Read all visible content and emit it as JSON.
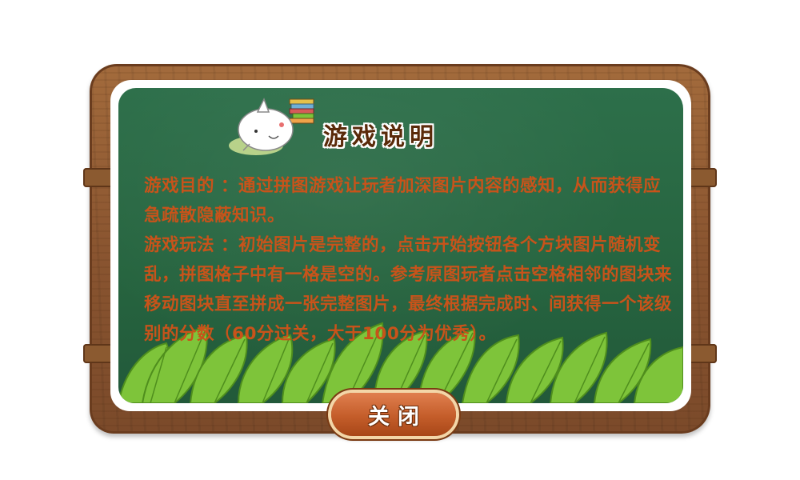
{
  "dialog": {
    "title": "游戏说明",
    "goal_label": "游戏目的 ：",
    "goal_text": "通过拼图游戏让玩者加深图片内容的感知，从而获得应急疏散隐蔽知识。",
    "play_label": "游戏玩法 ：",
    "play_text": "初始图片是完整的，点击开始按钮各个方块图片随机变乱，拼图格子中有一格是空的。参考原图玩者点击空格相邻的图块来移动图块直至拼成一张完整图片，最终根据完成时、间获得一个该级别的分数（60分过关，大于100分为优秀）。",
    "close_label": "关闭"
  },
  "colors": {
    "board_green": "#26643f",
    "wood_brown": "#8a5530",
    "text_orange": "#c8531a",
    "title_brown": "#5a2a0a",
    "button_orange": "#c45d2a"
  },
  "icons": {
    "mascot": "cat-with-books-icon",
    "decoration": "leaves-decoration"
  }
}
